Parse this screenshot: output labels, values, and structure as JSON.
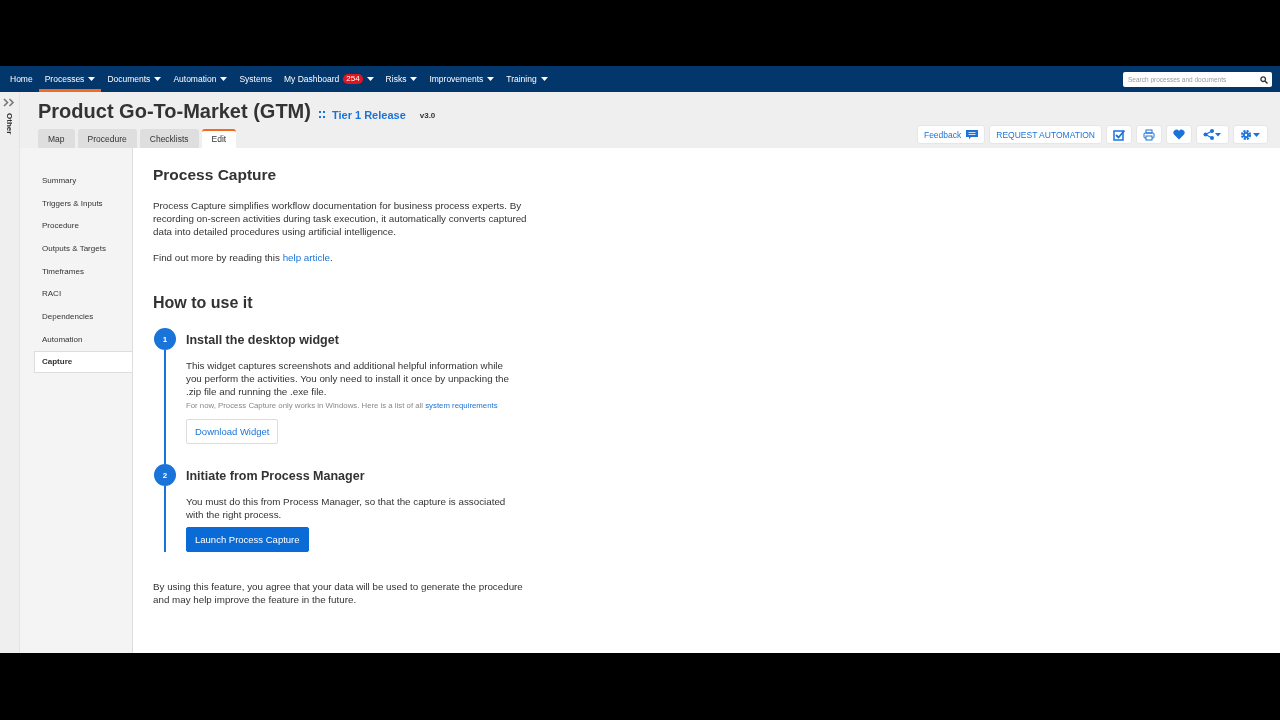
{
  "nav": {
    "items": [
      {
        "label": "Home",
        "selected": false,
        "dropdown": false
      },
      {
        "label": "Processes",
        "selected": true,
        "dropdown": true
      },
      {
        "label": "Documents",
        "selected": false,
        "dropdown": true
      },
      {
        "label": "Automation",
        "selected": false,
        "dropdown": true
      },
      {
        "label": "Systems",
        "selected": false,
        "dropdown": false
      },
      {
        "label": "My Dashboard",
        "selected": false,
        "dropdown": true,
        "badge": "254"
      },
      {
        "label": "Risks",
        "selected": false,
        "dropdown": true
      },
      {
        "label": "Improvements",
        "selected": false,
        "dropdown": true
      },
      {
        "label": "Training",
        "selected": false,
        "dropdown": true
      }
    ],
    "search": {
      "placeholder": "Search processes and documents"
    }
  },
  "side_tab": {
    "label": "Other"
  },
  "header": {
    "title": "Product Go-To-Market (GTM)",
    "release": "Tier 1 Release",
    "version": "v3.0",
    "tabs": [
      {
        "label": "Map",
        "selected": false
      },
      {
        "label": "Procedure",
        "selected": false
      },
      {
        "label": "Checklists",
        "selected": false
      },
      {
        "label": "Edit",
        "selected": true
      }
    ],
    "actions": [
      {
        "kind": "feedback",
        "label": "Feedback"
      },
      {
        "kind": "text",
        "label": "REQUEST AUTOMATION"
      },
      {
        "kind": "check"
      },
      {
        "kind": "print"
      },
      {
        "kind": "heart"
      },
      {
        "kind": "share"
      },
      {
        "kind": "settings"
      }
    ]
  },
  "sidebar": {
    "items": [
      {
        "label": "Summary",
        "selected": false
      },
      {
        "label": "Triggers & Inputs",
        "selected": false
      },
      {
        "label": "Procedure",
        "selected": false
      },
      {
        "label": "Outputs & Targets",
        "selected": false
      },
      {
        "label": "Timeframes",
        "selected": false
      },
      {
        "label": "RACI",
        "selected": false
      },
      {
        "label": "Dependencies",
        "selected": false
      },
      {
        "label": "Automation",
        "selected": false
      },
      {
        "label": "Capture",
        "selected": true
      }
    ]
  },
  "content": {
    "title": "Process Capture",
    "intro": "Process Capture simplifies workflow documentation for business process experts. By recording on-screen activities during task execution, it automatically converts captured data into detailed procedures using artificial intelligence.",
    "help": {
      "text": "Find out more by reading this",
      "link": "help article",
      "after": "."
    },
    "how_title": "How to use it",
    "steps": [
      {
        "number": "1",
        "title": "Install the desktop widget",
        "body": "This widget captures screenshots and additional helpful information while you perform the activities. You only need to install it once by unpacking the .zip file and running the .exe file.",
        "note": {
          "text": "For now, Process Capture only works in Windows. Here is a list of all",
          "link": "system requirements"
        },
        "button": {
          "label": "Download Widget",
          "kind": "secondary"
        }
      },
      {
        "number": "2",
        "title": "Initiate from Process Manager",
        "body": "You must do this from Process Manager, so that the capture is associated with the right process.",
        "button": {
          "label": "Launch Process Capture",
          "kind": "primary"
        }
      }
    ],
    "footer": "By using this feature, you agree that your data will be used to generate the procedure and may help improve the feature in the future."
  }
}
